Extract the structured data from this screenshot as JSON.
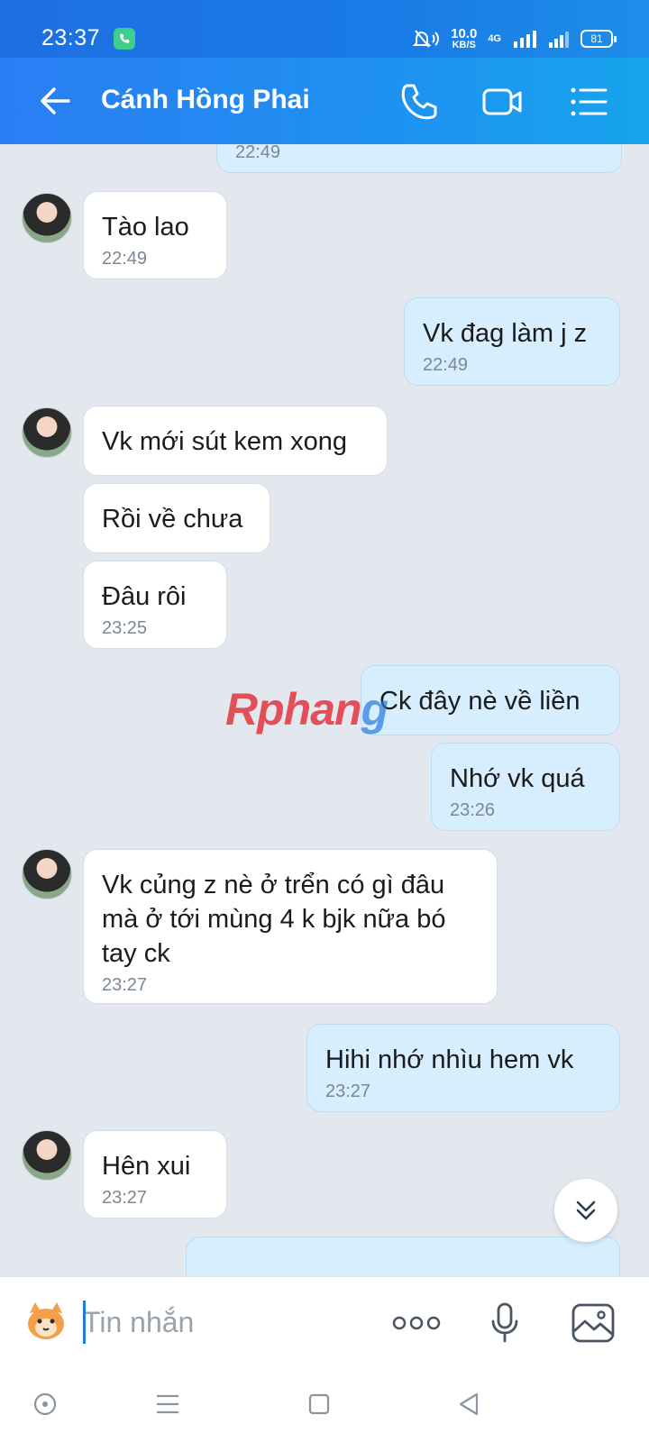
{
  "status": {
    "time": "23:37",
    "speed_value": "10.0",
    "speed_unit": "KB/S",
    "network": "4G",
    "battery": "81"
  },
  "header": {
    "contact_name": "Cánh Hồng Phai"
  },
  "messages": [
    {
      "time": "22:49"
    },
    {
      "text": "Tào lao",
      "time": "22:49"
    },
    {
      "text": "Vk đag làm j z",
      "time": "22:49"
    },
    {
      "text": "Vk mới sút kem xong"
    },
    {
      "text": "Rồi về chưa"
    },
    {
      "text": "Đâu rôi",
      "time": "23:25"
    },
    {
      "text": "Ck đây nè về liền"
    },
    {
      "text": "Nhớ vk quá",
      "time": "23:26"
    },
    {
      "text": "Vk củng z nè ở trển có gì đâu mà ở tới mùng 4 k bjk nữa bó tay ck",
      "time": "23:27"
    },
    {
      "text": "Hihi nhớ nhìu hem vk",
      "time": "23:27"
    },
    {
      "text": "Hên xui",
      "time": "23:27"
    }
  ],
  "watermark": {
    "part1": "Rphan",
    "part2": "g"
  },
  "input": {
    "placeholder": "Tin nhắn"
  }
}
